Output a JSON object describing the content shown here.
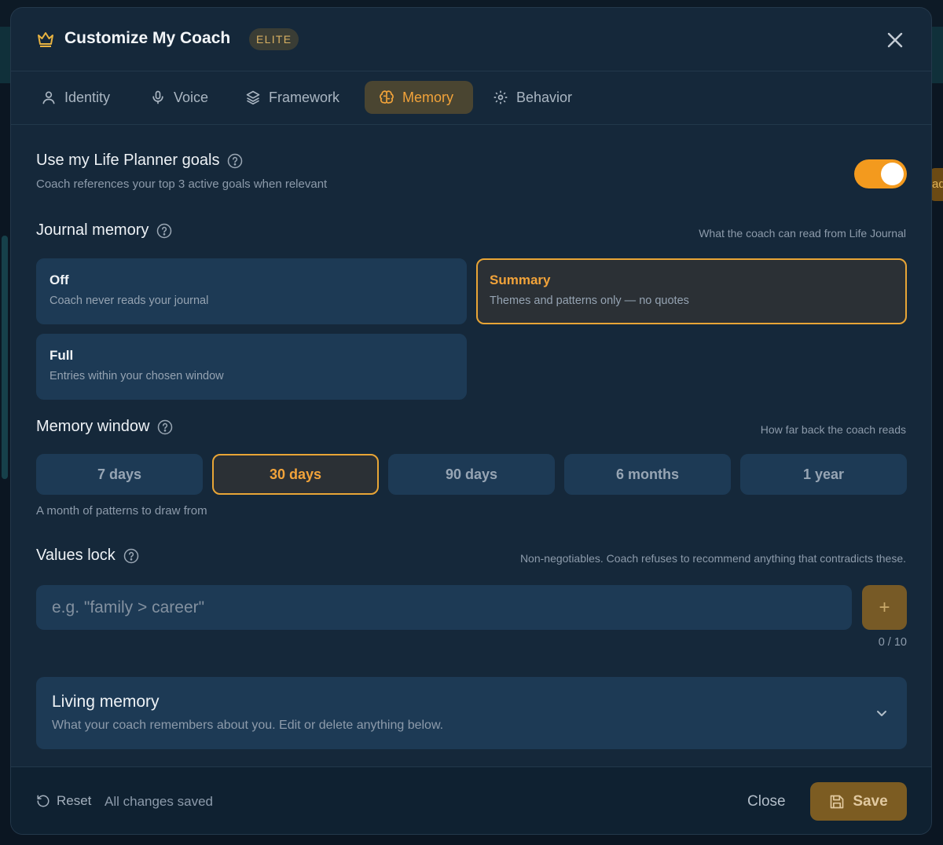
{
  "modal": {
    "title": "Customize My Coach",
    "badge": "ELITE",
    "accent": "#f2a33a"
  },
  "tabs": [
    {
      "label": "Identity",
      "icon": "user-icon"
    },
    {
      "label": "Voice",
      "icon": "microphone-icon"
    },
    {
      "label": "Framework",
      "icon": "layers-icon"
    },
    {
      "label": "Memory",
      "icon": "brain-icon",
      "active": true
    },
    {
      "label": "Behavior",
      "icon": "gear-icon"
    }
  ],
  "goals": {
    "title": "Use my Life Planner goals",
    "subtitle": "Coach references your top 3 active goals when relevant",
    "enabled": true
  },
  "journal": {
    "title": "Journal memory",
    "hint": "What the coach can read from Life Journal",
    "options": [
      {
        "title": "Off",
        "desc": "Coach never reads your journal"
      },
      {
        "title": "Summary",
        "desc": "Themes and patterns only — no quotes",
        "selected": true
      },
      {
        "title": "Full",
        "desc": "Entries within your chosen window"
      }
    ]
  },
  "window": {
    "title": "Memory window",
    "hint": "How far back the coach reads",
    "options": [
      "7 days",
      "30 days",
      "90 days",
      "6 months",
      "1 year"
    ],
    "selected": "30 days",
    "caption": "A month of patterns to draw from"
  },
  "values": {
    "title": "Values lock",
    "hint": "Non-negotiables. Coach refuses to recommend anything that contradicts these.",
    "placeholder": "e.g. \"family > career\"",
    "add_label": "+",
    "counter": "0 / 10"
  },
  "living": {
    "title": "Living memory",
    "subtitle": "What your coach remembers about you. Edit or delete anything below."
  },
  "footer": {
    "reset": "Reset",
    "status": "All changes saved",
    "close": "Close",
    "save": "Save"
  },
  "background": {
    "side_button_text": "ad"
  }
}
